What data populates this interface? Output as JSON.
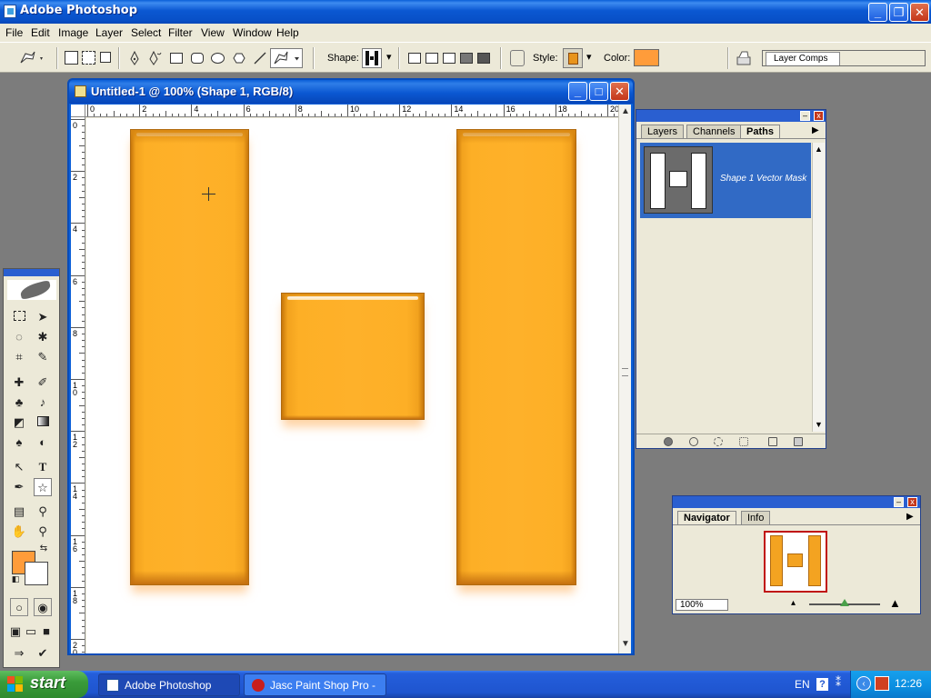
{
  "window": {
    "title": "Adobe Photoshop"
  },
  "menu": [
    "File",
    "Edit",
    "Image",
    "Layer",
    "Select",
    "Filter",
    "View",
    "Window",
    "Help"
  ],
  "options_bar": {
    "shape_label": "Shape:",
    "style_label": "Style:",
    "color_label": "Color:",
    "color_value": "#ff9c3a",
    "layer_comps_label": "Layer Comps"
  },
  "document": {
    "title": "Untitled-1 @ 100% (Shape 1, RGB/8)",
    "ruler_h": [
      "0",
      "2",
      "4",
      "6",
      "8",
      "10",
      "12",
      "14",
      "16",
      "18",
      "20"
    ],
    "ruler_v": [
      "0",
      "2",
      "4",
      "6",
      "8",
      "10",
      "12",
      "14",
      "16",
      "18",
      "20"
    ],
    "shape_color": "#feb12a"
  },
  "paths_palette": {
    "tabs": [
      "Layers",
      "Channels",
      "Paths"
    ],
    "active_tab": "Paths",
    "path_name": "Shape 1 Vector Mask"
  },
  "navigator": {
    "tabs": [
      "Navigator",
      "Info"
    ],
    "active_tab": "Navigator",
    "zoom": "100%"
  },
  "toolbox": {
    "foreground": "#ff9c3a",
    "background": "#ffffff"
  },
  "taskbar": {
    "start_label": "start",
    "tasks": [
      "Adobe Photoshop",
      "Jasc Paint Shop Pro - ..."
    ],
    "tray_lang": "EN",
    "clock": "12:26"
  }
}
